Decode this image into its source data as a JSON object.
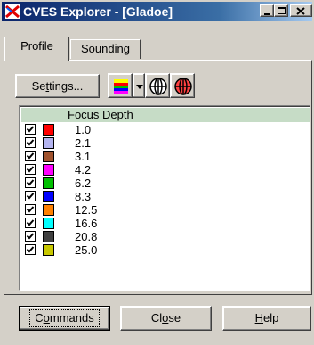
{
  "window": {
    "title": "CVES Explorer - [Gladoe]"
  },
  "tabs": [
    {
      "label": "Profile",
      "active": true
    },
    {
      "label": "Sounding",
      "active": false
    }
  ],
  "toolbar": {
    "settings_label": "Settings...",
    "icons": [
      "colormap-icon",
      "dropdown-arrow-icon",
      "globe-icon",
      "target-globe-icon"
    ]
  },
  "list": {
    "header": "Focus Depth",
    "rows": [
      {
        "depth": "1.0",
        "color": "#ff0000",
        "checked": true
      },
      {
        "depth": "2.1",
        "color": "#b4b4f0",
        "checked": true
      },
      {
        "depth": "3.1",
        "color": "#a0522d",
        "checked": true
      },
      {
        "depth": "4.2",
        "color": "#ff00ff",
        "checked": true
      },
      {
        "depth": "6.2",
        "color": "#00c000",
        "checked": true
      },
      {
        "depth": "8.3",
        "color": "#0000ff",
        "checked": true
      },
      {
        "depth": "12.5",
        "color": "#ff8000",
        "checked": true
      },
      {
        "depth": "16.6",
        "color": "#00ffff",
        "checked": true
      },
      {
        "depth": "20.8",
        "color": "#404040",
        "checked": true
      },
      {
        "depth": "25.0",
        "color": "#c8c800",
        "checked": true
      }
    ]
  },
  "buttons": {
    "commands": "Commands",
    "close": "Close",
    "help": "Help"
  }
}
